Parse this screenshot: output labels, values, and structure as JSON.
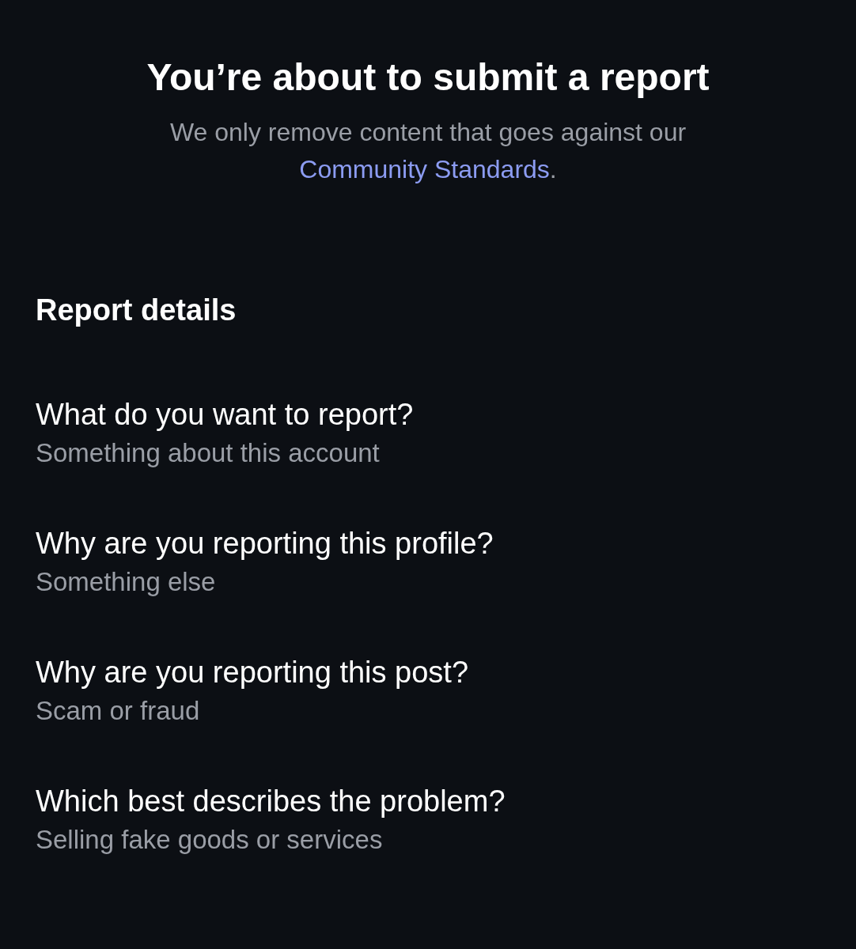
{
  "title": "You’re about to submit a report",
  "notice": {
    "text": "We only remove content that goes against our",
    "link": "Community Standards",
    "end": "."
  },
  "section_title": "Report details",
  "details": [
    {
      "question": "What do you want to report?",
      "answer": "Something about this account"
    },
    {
      "question": "Why are you reporting this profile?",
      "answer": "Something else"
    },
    {
      "question": "Why are you reporting this post?",
      "answer": "Scam or fraud"
    },
    {
      "question": "Which best describes the problem?",
      "answer": "Selling fake goods or services"
    }
  ]
}
